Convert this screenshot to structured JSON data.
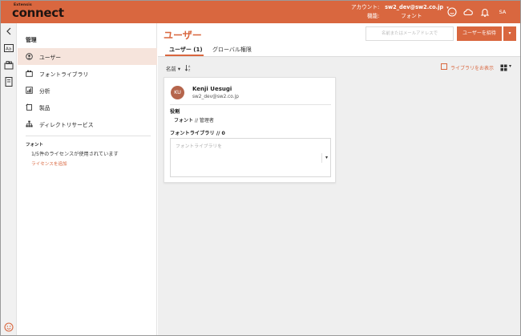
{
  "app": {
    "brand_small": "Extensis",
    "brand_main": "connect"
  },
  "topbar": {
    "account_label": "アカウント:",
    "account_value": "sw2_dev@sw2.co.jp",
    "feature_label": "機能:",
    "feature_value": "フォント",
    "avatar_initials": "SA",
    "icons": [
      "smiley-icon",
      "cloud-sync-icon",
      "bell-icon"
    ],
    "accent_color": "#d9673f"
  },
  "rail": {
    "icons": [
      "back-icon",
      "font-sample-icon",
      "font-library-icon",
      "book-icon",
      "feedback-icon"
    ]
  },
  "sidebar": {
    "title": "管理",
    "items": [
      {
        "label": "ユーザー",
        "icon": "user-icon",
        "active": true
      },
      {
        "label": "フォントライブラリ",
        "icon": "font-library-icon",
        "active": false
      },
      {
        "label": "分析",
        "icon": "analytics-icon",
        "active": false
      },
      {
        "label": "製品",
        "icon": "product-icon",
        "active": false
      },
      {
        "label": "ディレクトリサービス",
        "icon": "directory-icon",
        "active": false
      }
    ],
    "font_section_title": "フォント",
    "license_text": "1/5件のライセンスが使用されています",
    "add_license_link": "ライセンスを追加"
  },
  "main": {
    "page_title": "ユーザー",
    "search_placeholder": "名前またはメールアドレスで",
    "invite_button": "ユーザーを招待",
    "tabs": [
      {
        "label": "ユーザー (1)",
        "active": true
      },
      {
        "label": "グローバル権限",
        "active": false
      }
    ],
    "sort_label": "名前",
    "show_library_label": "ライブラリをお表示",
    "view_mode": "grid"
  },
  "user_card": {
    "initials": "KU",
    "name": "Kenji Uesugi",
    "email": "sw2_dev@sw2.co.jp",
    "role_label": "役割",
    "role_type": "フォント",
    "role_sep": "//",
    "role_value": "管理者",
    "library_label": "フォントライブラリ // 0",
    "library_placeholder": "フォントライブラリを"
  }
}
